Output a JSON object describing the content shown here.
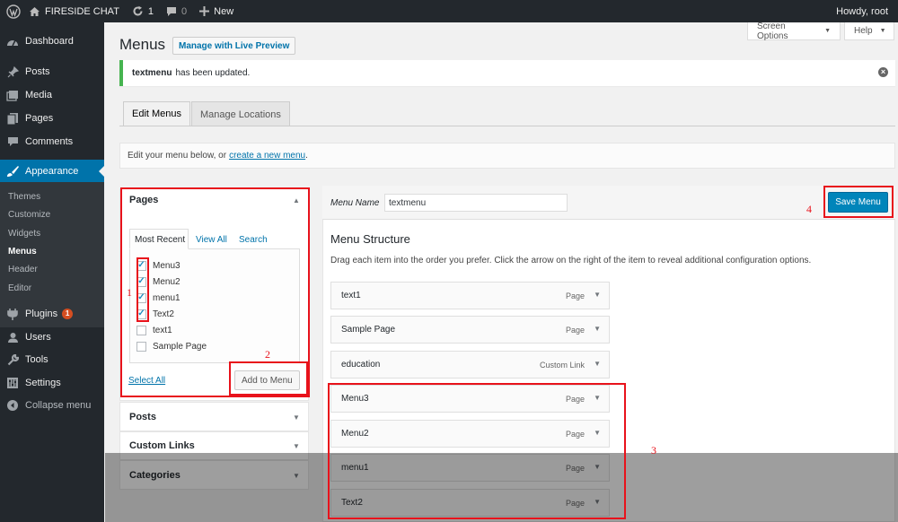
{
  "admin_bar": {
    "site_name": "FIRESIDE CHAT",
    "updates_count": "1",
    "comments_count": "0",
    "new_label": "New",
    "howdy": "Howdy, root"
  },
  "sidebar": {
    "items": [
      {
        "label": "Dashboard",
        "icon": "dashboard-icon"
      },
      {
        "label": "Posts",
        "icon": "pin-icon"
      },
      {
        "label": "Media",
        "icon": "media-icon"
      },
      {
        "label": "Pages",
        "icon": "pages-icon"
      },
      {
        "label": "Comments",
        "icon": "comment-icon"
      },
      {
        "label": "Appearance",
        "icon": "brush-icon"
      },
      {
        "label": "Plugins",
        "icon": "plugin-icon",
        "badge": "1"
      },
      {
        "label": "Users",
        "icon": "users-icon"
      },
      {
        "label": "Tools",
        "icon": "wrench-icon"
      },
      {
        "label": "Settings",
        "icon": "settings-icon"
      },
      {
        "label": "Collapse menu",
        "icon": "collapse-icon"
      }
    ],
    "appearance_sub": [
      "Themes",
      "Customize",
      "Widgets",
      "Menus",
      "Header",
      "Editor"
    ]
  },
  "header": {
    "title": "Menus",
    "live_preview": "Manage with Live Preview",
    "screen_options": "Screen Options",
    "help": "Help"
  },
  "notice": {
    "menu_name": "textmenu",
    "message": "has been updated."
  },
  "tabs": {
    "edit_menus": "Edit Menus",
    "manage_locations": "Manage Locations"
  },
  "manage": {
    "text": "Edit your menu below, or",
    "link": "create a new menu",
    "end": "."
  },
  "left_panel": {
    "pages_title": "Pages",
    "tabs": [
      "Most Recent",
      "View All",
      "Search"
    ],
    "pages": [
      {
        "label": "Menu3",
        "checked": true
      },
      {
        "label": "Menu2",
        "checked": true
      },
      {
        "label": "menu1",
        "checked": true
      },
      {
        "label": "Text2",
        "checked": true
      },
      {
        "label": "text1",
        "checked": false
      },
      {
        "label": "Sample Page",
        "checked": false
      }
    ],
    "select_all": "Select All",
    "add_to_menu": "Add to Menu",
    "posts_title": "Posts",
    "custom_links_title": "Custom Links",
    "categories_title": "Categories"
  },
  "menu_editor": {
    "name_label": "Menu Name",
    "name_value": "textmenu",
    "save_label": "Save Menu",
    "structure_title": "Menu Structure",
    "structure_desc": "Drag each item into the order you prefer. Click the arrow on the right of the item to reveal additional configuration options.",
    "items": [
      {
        "title": "text1",
        "type": "Page"
      },
      {
        "title": "Sample Page",
        "type": "Page"
      },
      {
        "title": "education",
        "type": "Custom Link"
      },
      {
        "title": "Menu3",
        "type": "Page"
      },
      {
        "title": "Menu2",
        "type": "Page"
      },
      {
        "title": "menu1",
        "type": "Page"
      },
      {
        "title": "Text2",
        "type": "Page"
      }
    ]
  },
  "annotations": [
    "1",
    "2",
    "3",
    "4"
  ],
  "colors": {
    "annotation_red": "#e8121b",
    "accent_blue": "#0073aa",
    "admin_dark": "#23282d",
    "notice_green": "#46b450"
  }
}
